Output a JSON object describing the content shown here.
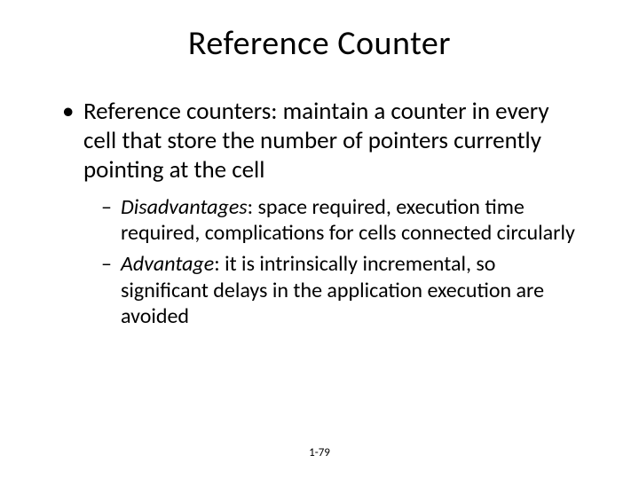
{
  "title": "Reference Counter",
  "bullets": [
    {
      "text": "Reference counters: maintain a counter in every cell that store the number of pointers currently pointing at the cell",
      "sub": [
        {
          "label": "Disadvantages",
          "text": ": space required, execution time required, complications for cells connected circularly"
        },
        {
          "label": "Advantage",
          "text": ": it is intrinsically incremental, so significant delays in the application execution are avoided"
        }
      ]
    }
  ],
  "footer": "1-79"
}
